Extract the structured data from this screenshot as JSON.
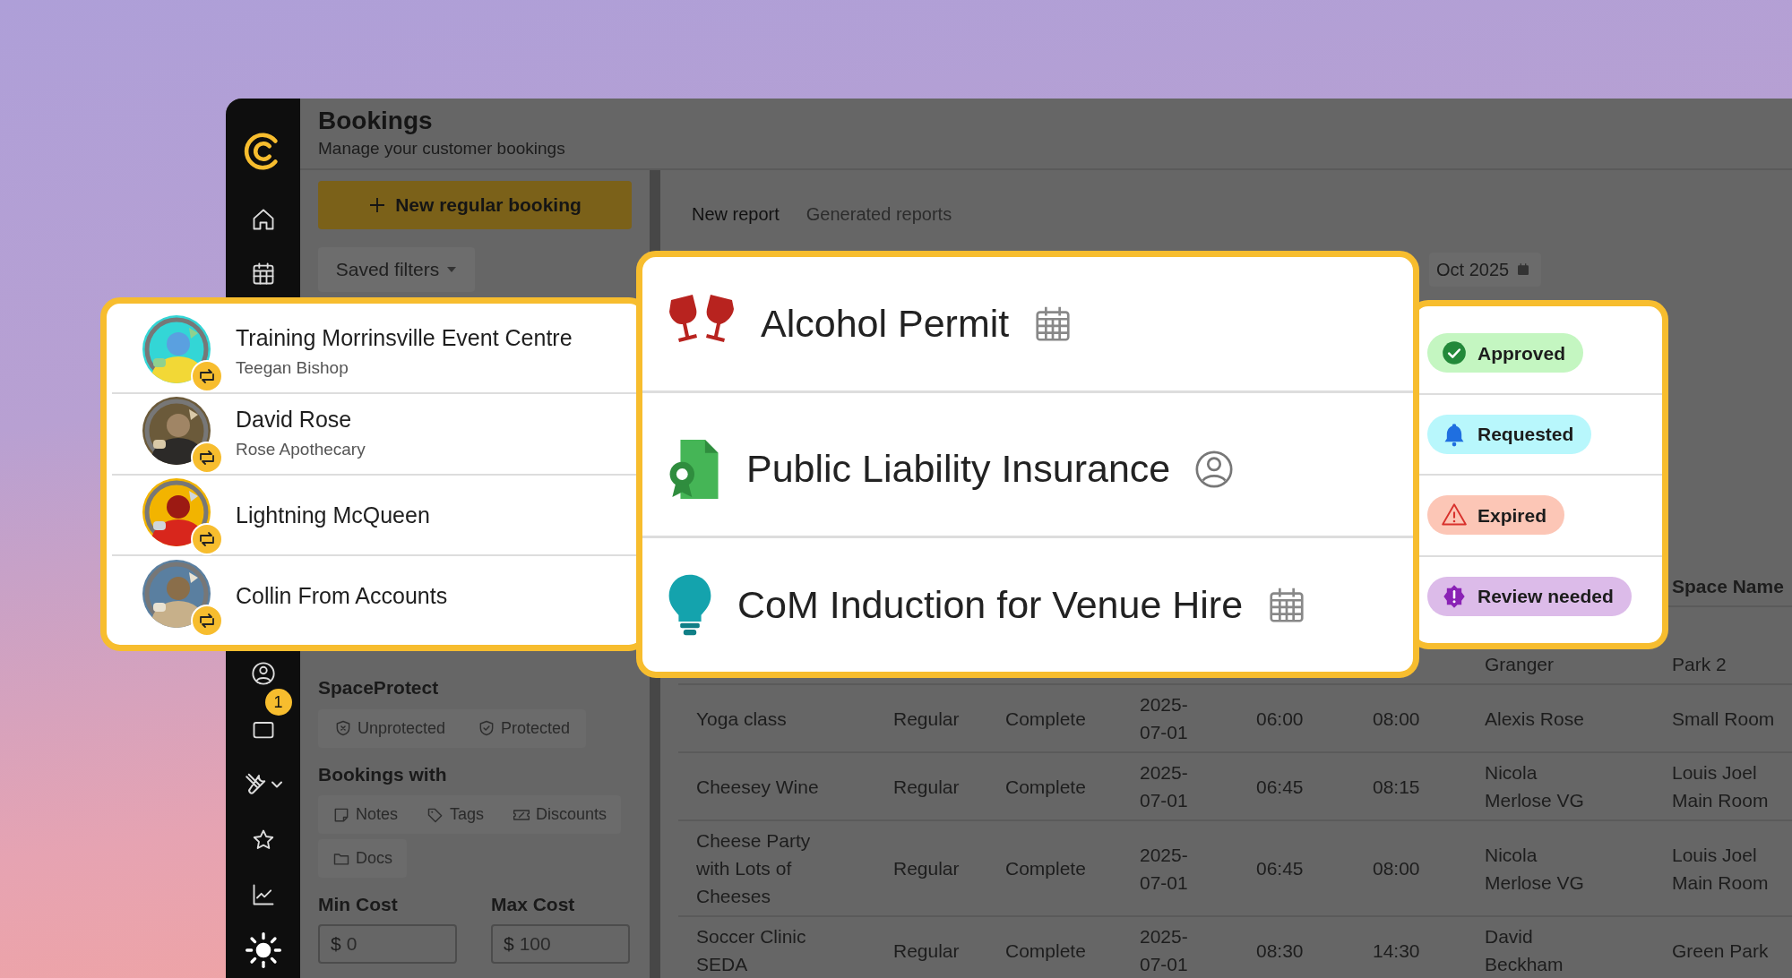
{
  "app": {
    "title": "Bookings",
    "subtitle": "Manage your customer bookings",
    "notification_count": "1"
  },
  "filters": {
    "new_button": "New regular booking",
    "saved_filters": "Saved filters",
    "groups": [
      {
        "title": "SpaceProtect",
        "options": [
          "Unprotected",
          "Protected"
        ]
      },
      {
        "title": "Bookings with",
        "options": [
          "Notes",
          "Tags",
          "Discounts",
          "Docs"
        ]
      }
    ],
    "cost": [
      {
        "label": "Min Cost",
        "prefix": "$",
        "placeholder": "0"
      },
      {
        "label": "Max Cost",
        "prefix": "$",
        "placeholder": "100"
      }
    ]
  },
  "report_tabs": [
    {
      "label": "New report",
      "selected": true
    },
    {
      "label": "Generated reports",
      "selected": false
    }
  ],
  "date_field": {
    "value": "Oct 2025"
  },
  "table": {
    "space_header": "Space Name",
    "rows": [
      {
        "booker": "Granger",
        "space": "Park 2"
      },
      {
        "event": "Yoga class",
        "type": "Regular",
        "status": "Complete",
        "date": "2025-07-01",
        "start": "06:00",
        "end": "08:00",
        "booker": "Alexis Rose",
        "space": "Small Room"
      },
      {
        "event": "Cheesey Wine",
        "type": "Regular",
        "status": "Complete",
        "date": "2025-07-01",
        "start": "06:45",
        "end": "08:15",
        "booker": "Nicola Merlose VG",
        "space": "Louis Joel Main Room"
      },
      {
        "event": "Cheese Party with Lots of Cheeses",
        "type": "Regular",
        "status": "Complete",
        "date": "2025-07-01",
        "start": "06:45",
        "end": "08:00",
        "booker": "Nicola Merlose VG",
        "space": "Louis Joel Main Room"
      },
      {
        "event": "Soccer Clinic SEDA",
        "type": "Regular",
        "status": "Complete",
        "date": "2025-07-01",
        "start": "08:30",
        "end": "14:30",
        "booker": "David Beckham",
        "space": "Green Park"
      }
    ]
  },
  "contacts": [
    {
      "name": "Training Morrinsville Event Centre",
      "subtitle": "Teegan Bishop"
    },
    {
      "name": "David Rose",
      "subtitle": "Rose Apothecary"
    },
    {
      "name": "Lightning McQueen"
    },
    {
      "name": "Collin From Accounts"
    }
  ],
  "requirements": [
    {
      "title": "Alcohol Permit",
      "kind": "date"
    },
    {
      "title": "Public Liability Insurance",
      "kind": "person"
    },
    {
      "title": "CoM Induction for Venue Hire",
      "kind": "date"
    }
  ],
  "statuses": [
    {
      "label": "Approved",
      "kind": "approved",
      "color": "#c4f6c1"
    },
    {
      "label": "Requested",
      "kind": "requested",
      "color": "#b8f7fc"
    },
    {
      "label": "Expired",
      "kind": "expired",
      "color": "#fcc6b6"
    },
    {
      "label": "Review needed",
      "kind": "review",
      "color": "#dcbbe9"
    }
  ]
}
